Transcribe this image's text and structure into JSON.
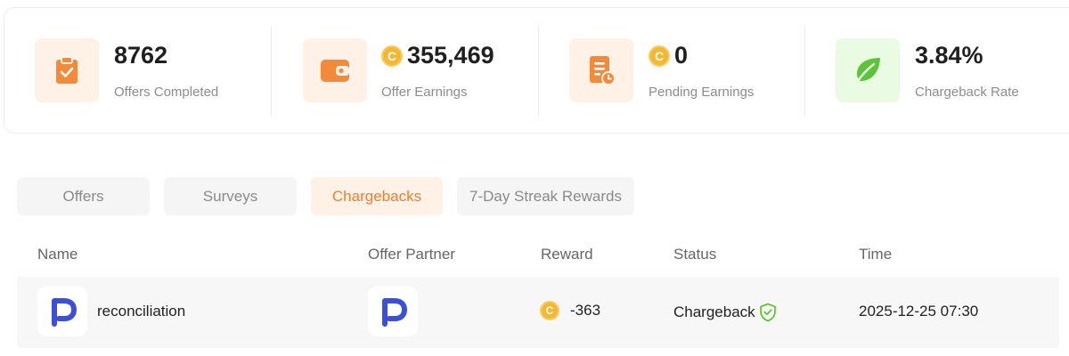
{
  "stats": [
    {
      "value": "8762",
      "label": "Offers Completed",
      "icon": "clipboard-check-icon",
      "has_coin": false
    },
    {
      "value": "355,469",
      "label": "Offer Earnings",
      "icon": "wallet-icon",
      "has_coin": true
    },
    {
      "value": "0",
      "label": "Pending Earnings",
      "icon": "receipt-clock-icon",
      "has_coin": true
    },
    {
      "value": "3.84%",
      "label": "Chargeback Rate",
      "icon": "leaf-icon",
      "has_coin": false
    }
  ],
  "coin_symbol": "C",
  "tabs": [
    {
      "label": "Offers",
      "active": false
    },
    {
      "label": "Surveys",
      "active": false
    },
    {
      "label": "Chargebacks",
      "active": true
    },
    {
      "label": "7-Day Streak Rewards",
      "active": false
    }
  ],
  "table": {
    "columns": [
      "Name",
      "Offer Partner",
      "Reward",
      "Status",
      "Time"
    ],
    "rows": [
      {
        "name": "reconciliation",
        "partner_logo": "p-logo-icon",
        "reward": "-363",
        "status": "Chargeback",
        "time": "2025-12-25 07:30"
      }
    ]
  },
  "colors": {
    "accent_orange": "#f07f2c",
    "orange_bg": "#fff1e6",
    "green": "#52c41a",
    "green_bg": "#eafbe3",
    "coin": "#f5b731",
    "logo_blue": "#3b4fd8"
  }
}
